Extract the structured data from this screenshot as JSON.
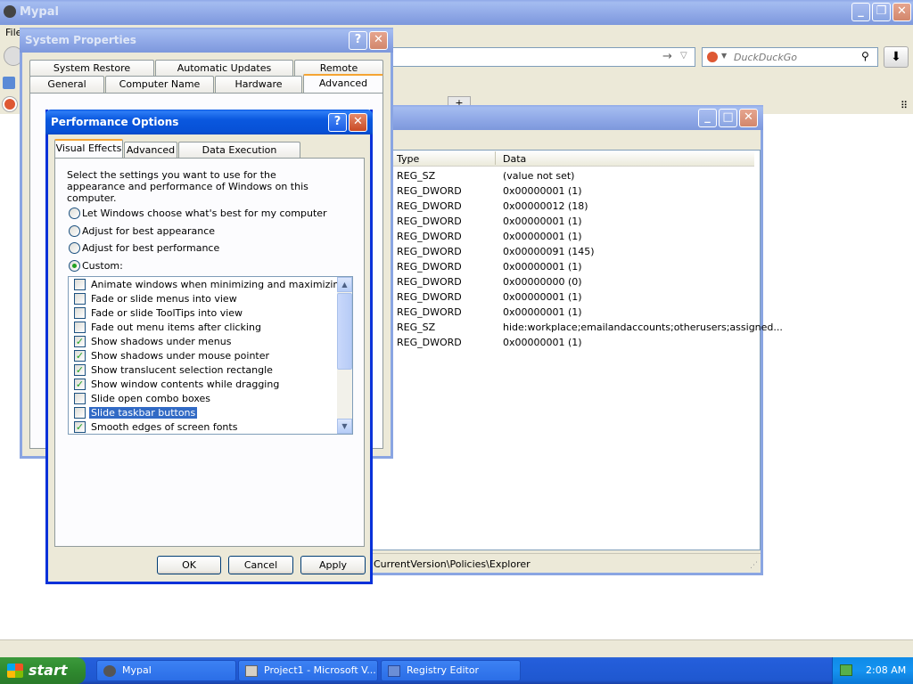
{
  "browser": {
    "title": "Mypal",
    "menu_file": "File",
    "search_placeholder": "DuckDuckGo",
    "statusbar_path": "CurrentVersion\\Policies\\Explorer"
  },
  "system_properties": {
    "title": "System Properties",
    "tabs_row1": [
      "System Restore",
      "Automatic Updates",
      "Remote"
    ],
    "tabs_row2": [
      "General",
      "Computer Name",
      "Hardware",
      "Advanced"
    ]
  },
  "registry": {
    "columns": [
      "Type",
      "Data"
    ],
    "rows": [
      {
        "type": "REG_SZ",
        "data": "(value not set)"
      },
      {
        "type": "REG_DWORD",
        "data": "0x00000001 (1)"
      },
      {
        "type": "REG_DWORD",
        "data": "0x00000012 (18)"
      },
      {
        "type": "REG_DWORD",
        "data": "0x00000001 (1)"
      },
      {
        "type": "REG_DWORD",
        "data": "0x00000001 (1)"
      },
      {
        "type": "REG_DWORD",
        "data": "0x00000091 (145)"
      },
      {
        "type": "REG_DWORD",
        "data": "0x00000001 (1)"
      },
      {
        "type": "REG_DWORD",
        "data": "0x00000000 (0)"
      },
      {
        "type": "REG_DWORD",
        "data": "0x00000001 (1)"
      },
      {
        "type": "REG_DWORD",
        "data": "0x00000001 (1)"
      },
      {
        "type": "REG_SZ",
        "data": "hide:workplace;emailandaccounts;otherusers;assigned..."
      },
      {
        "type": "REG_DWORD",
        "data": "0x00000001 (1)"
      }
    ]
  },
  "performance": {
    "title": "Performance Options",
    "tabs": [
      "Visual Effects",
      "Advanced",
      "Data Execution Prevention"
    ],
    "description": "Select the settings you want to use for the appearance and performance of Windows on this computer.",
    "radios": [
      {
        "label": "Let Windows choose what's best for my computer",
        "selected": false
      },
      {
        "label": "Adjust for best appearance",
        "selected": false
      },
      {
        "label": "Adjust for best performance",
        "selected": false
      },
      {
        "label": "Custom:",
        "selected": true
      }
    ],
    "checks": [
      {
        "label": "Animate windows when minimizing and maximizing",
        "checked": false
      },
      {
        "label": "Fade or slide menus into view",
        "checked": false
      },
      {
        "label": "Fade or slide ToolTips into view",
        "checked": false
      },
      {
        "label": "Fade out menu items after clicking",
        "checked": false
      },
      {
        "label": "Show shadows under menus",
        "checked": true
      },
      {
        "label": "Show shadows under mouse pointer",
        "checked": true
      },
      {
        "label": "Show translucent selection rectangle",
        "checked": true
      },
      {
        "label": "Show window contents while dragging",
        "checked": true
      },
      {
        "label": "Slide open combo boxes",
        "checked": false
      },
      {
        "label": "Slide taskbar buttons",
        "checked": false,
        "highlighted": true
      },
      {
        "label": "Smooth edges of screen fonts",
        "checked": true
      }
    ],
    "ok": "OK",
    "cancel": "Cancel",
    "apply": "Apply"
  },
  "taskbar": {
    "start": "start",
    "items": [
      "Mypal",
      "Project1 - Microsoft V...",
      "Registry Editor"
    ],
    "clock": "2:08 AM"
  },
  "colors": {
    "xp_blue": "#0a58df",
    "start_green": "#3c9a3c",
    "highlight": "#316ac5"
  }
}
